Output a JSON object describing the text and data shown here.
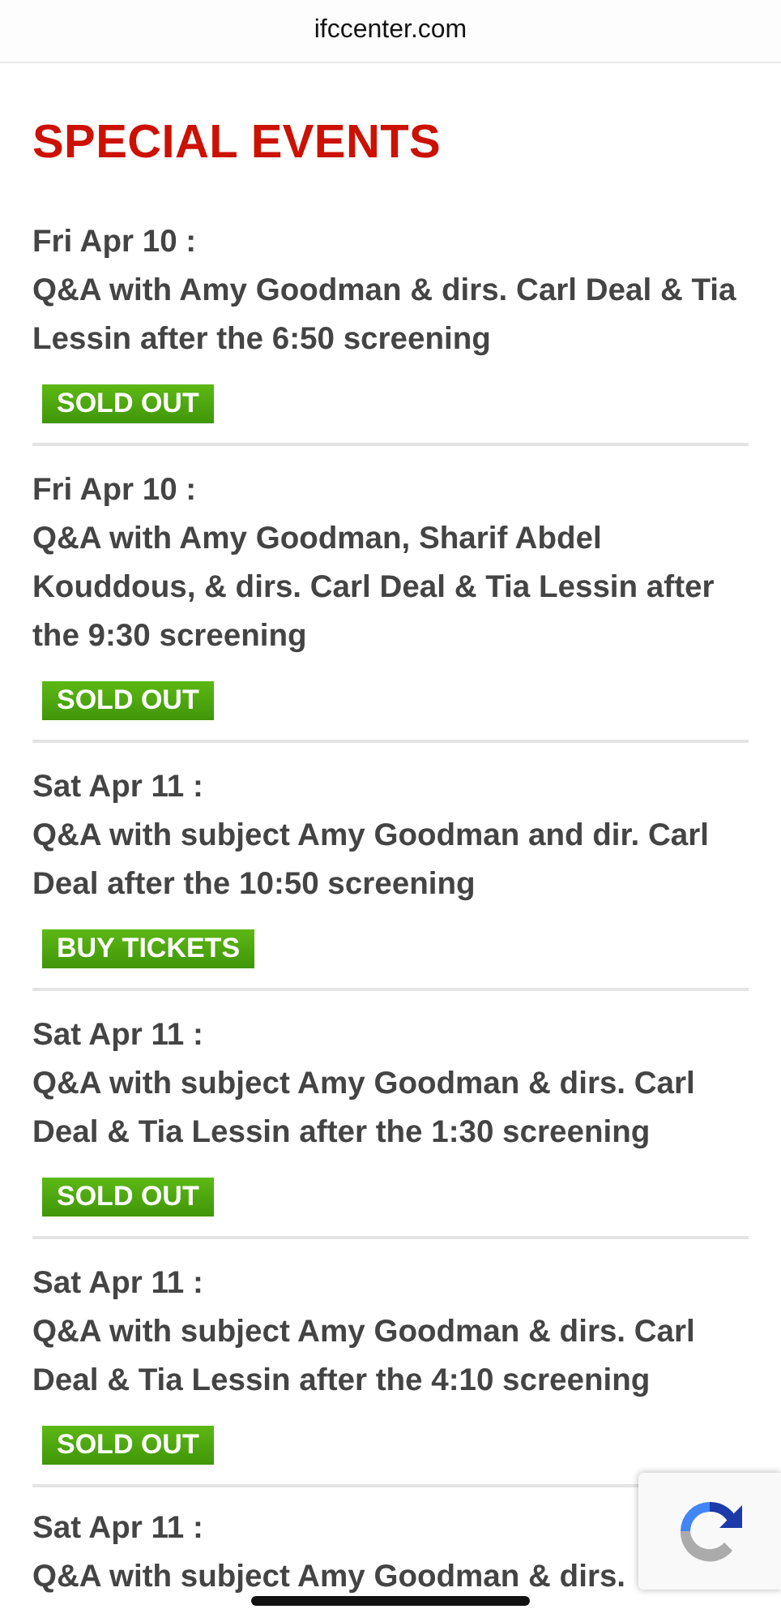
{
  "address_bar": {
    "url": "ifccenter.com"
  },
  "heading": "SPECIAL EVENTS",
  "events": [
    {
      "date": "Fri Apr 10 :",
      "description": "Q&A with Amy Goodman & dirs. Carl Deal & Tia Lessin after the 6:50 screening",
      "button": "SOLD OUT"
    },
    {
      "date": "Fri Apr 10 :",
      "description": "Q&A with Amy Goodman, Sharif Abdel Kouddous, & dirs. Carl Deal & Tia Lessin after the 9:30 screening",
      "button": "SOLD OUT"
    },
    {
      "date": "Sat Apr 11 :",
      "description": "Q&A with subject Amy Goodman and dir. Carl Deal after the 10:50 screening",
      "button": "BUY TICKETS"
    },
    {
      "date": "Sat Apr 11 :",
      "description": "Q&A with subject Amy Goodman & dirs. Carl Deal & Tia Lessin after the 1:30 screening",
      "button": "SOLD OUT"
    },
    {
      "date": "Sat Apr 11 :",
      "description": "Q&A with subject Amy Goodman & dirs. Carl Deal & Tia Lessin after the 4:10 screening",
      "button": "SOLD OUT"
    },
    {
      "date": "Sat Apr 11 :",
      "description": "Q&A with subject Amy Goodman & dirs."
    }
  ]
}
